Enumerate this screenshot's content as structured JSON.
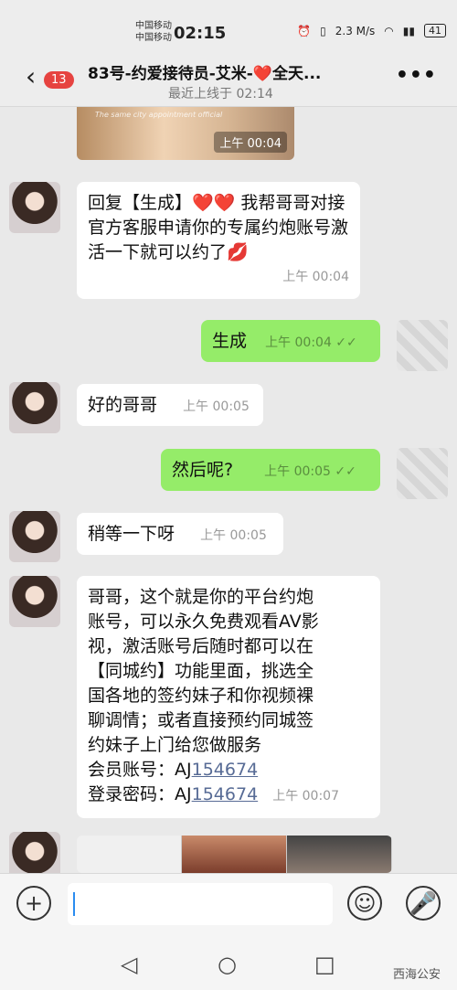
{
  "status": {
    "carrier1": "中国移动",
    "carrier2": "中国移动",
    "time": "02:15",
    "speed": "2.3 M/s",
    "battery": "41"
  },
  "header": {
    "badge": "13",
    "title": "83号-约爱接待员-艾米-❤️全天...",
    "subtitle": "最近上线于 02:14"
  },
  "image_top": {
    "caption": "The same city appointment official",
    "time": "上午 00:04"
  },
  "messages": [
    {
      "side": "left",
      "text": "回复【生成】❤️❤️ 我帮哥哥对接官方客服申请你的专属约炮账号激活一下就可以约了💋",
      "time": "上午 00:04"
    },
    {
      "side": "right",
      "text": "生成",
      "time": "上午 00:04 ✓✓"
    },
    {
      "side": "left",
      "text": "好的哥哥",
      "time": "上午 00:05"
    },
    {
      "side": "right",
      "text": "然后呢?",
      "time": "上午 00:05 ✓✓"
    },
    {
      "side": "left",
      "text": "稍等一下呀",
      "time": "上午 00:05"
    },
    {
      "side": "left",
      "text_lines": [
        "哥哥，这个就是你的平台约炮",
        "账号，可以永久免费观看AV影",
        "视，激活账号后随时都可以在",
        "【同城约】功能里面，挑选全",
        "国各地的签约妹子和你视频裸",
        "聊调情；或者直接预约同城签",
        "约妹子上门给您做服务"
      ],
      "account_label": "会员账号：",
      "account_prefix": "AJ",
      "account_num": "154674",
      "password_label": "登录密码：",
      "password_prefix": "AJ",
      "password_num": "154674",
      "time": "上午 00:07"
    }
  ],
  "watermark": "西海公安"
}
